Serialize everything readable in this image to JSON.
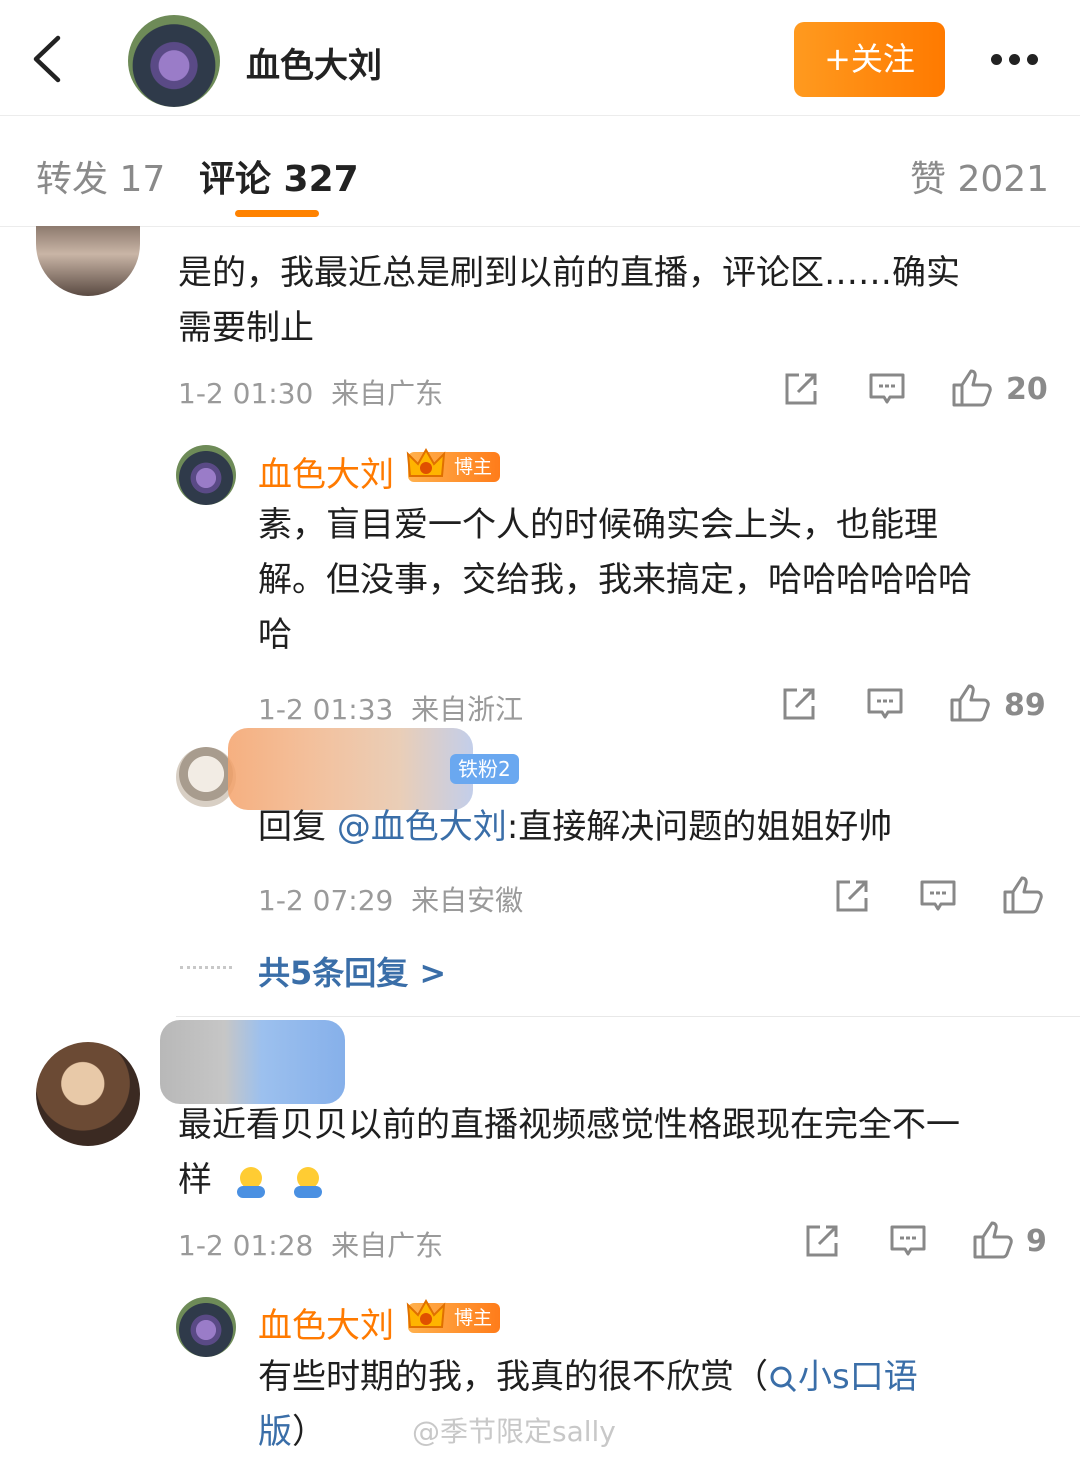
{
  "header": {
    "title": "血色大刘",
    "follow_label": "+关注"
  },
  "tabs": {
    "repost": "转发 17",
    "comments": "评论 327",
    "likes": "赞 2021"
  },
  "comments": [
    {
      "text_line1": "是的，我最近总是刷到以前的直播，评论区……确实",
      "text_line2": "需要制止",
      "time": "1-2 01:30",
      "location": "来自广东",
      "likes": "20",
      "replies": [
        {
          "author": "血色大刘",
          "badge": "博主",
          "line1": "素，盲目爱一个人的时候确实会上头，也能理",
          "line2": "解。但没事，交给我，我来搞定，哈哈哈哈哈哈",
          "line3": "哈",
          "time": "1-2 01:33",
          "location": "来自浙江",
          "likes": "89"
        },
        {
          "fan_badge": "铁粉2",
          "reply_prefix": "回复",
          "mention": "@血色大刘",
          "text": ":直接解决问题的姐姐好帅",
          "time": "1-2 07:29",
          "location": "来自安徽"
        }
      ],
      "more_replies": "共5条回复 >"
    },
    {
      "line1": "最近看贝贝以前的直播视频感觉性格跟现在完全不一",
      "line2": "样",
      "time": "1-2 01:28",
      "location": "来自广东",
      "likes": "9",
      "reply": {
        "author": "血色大刘",
        "badge": "博主",
        "line1": "有些时期的我，我真的很不欣赏（",
        "link": "小s口语",
        "line2_link": "版",
        "line2_end": "）"
      }
    }
  ],
  "watermark": "@季节限定sally",
  "colors": {
    "accent": "#ff8200",
    "link": "#3a6ea8",
    "meta": "#9a9a9a"
  }
}
